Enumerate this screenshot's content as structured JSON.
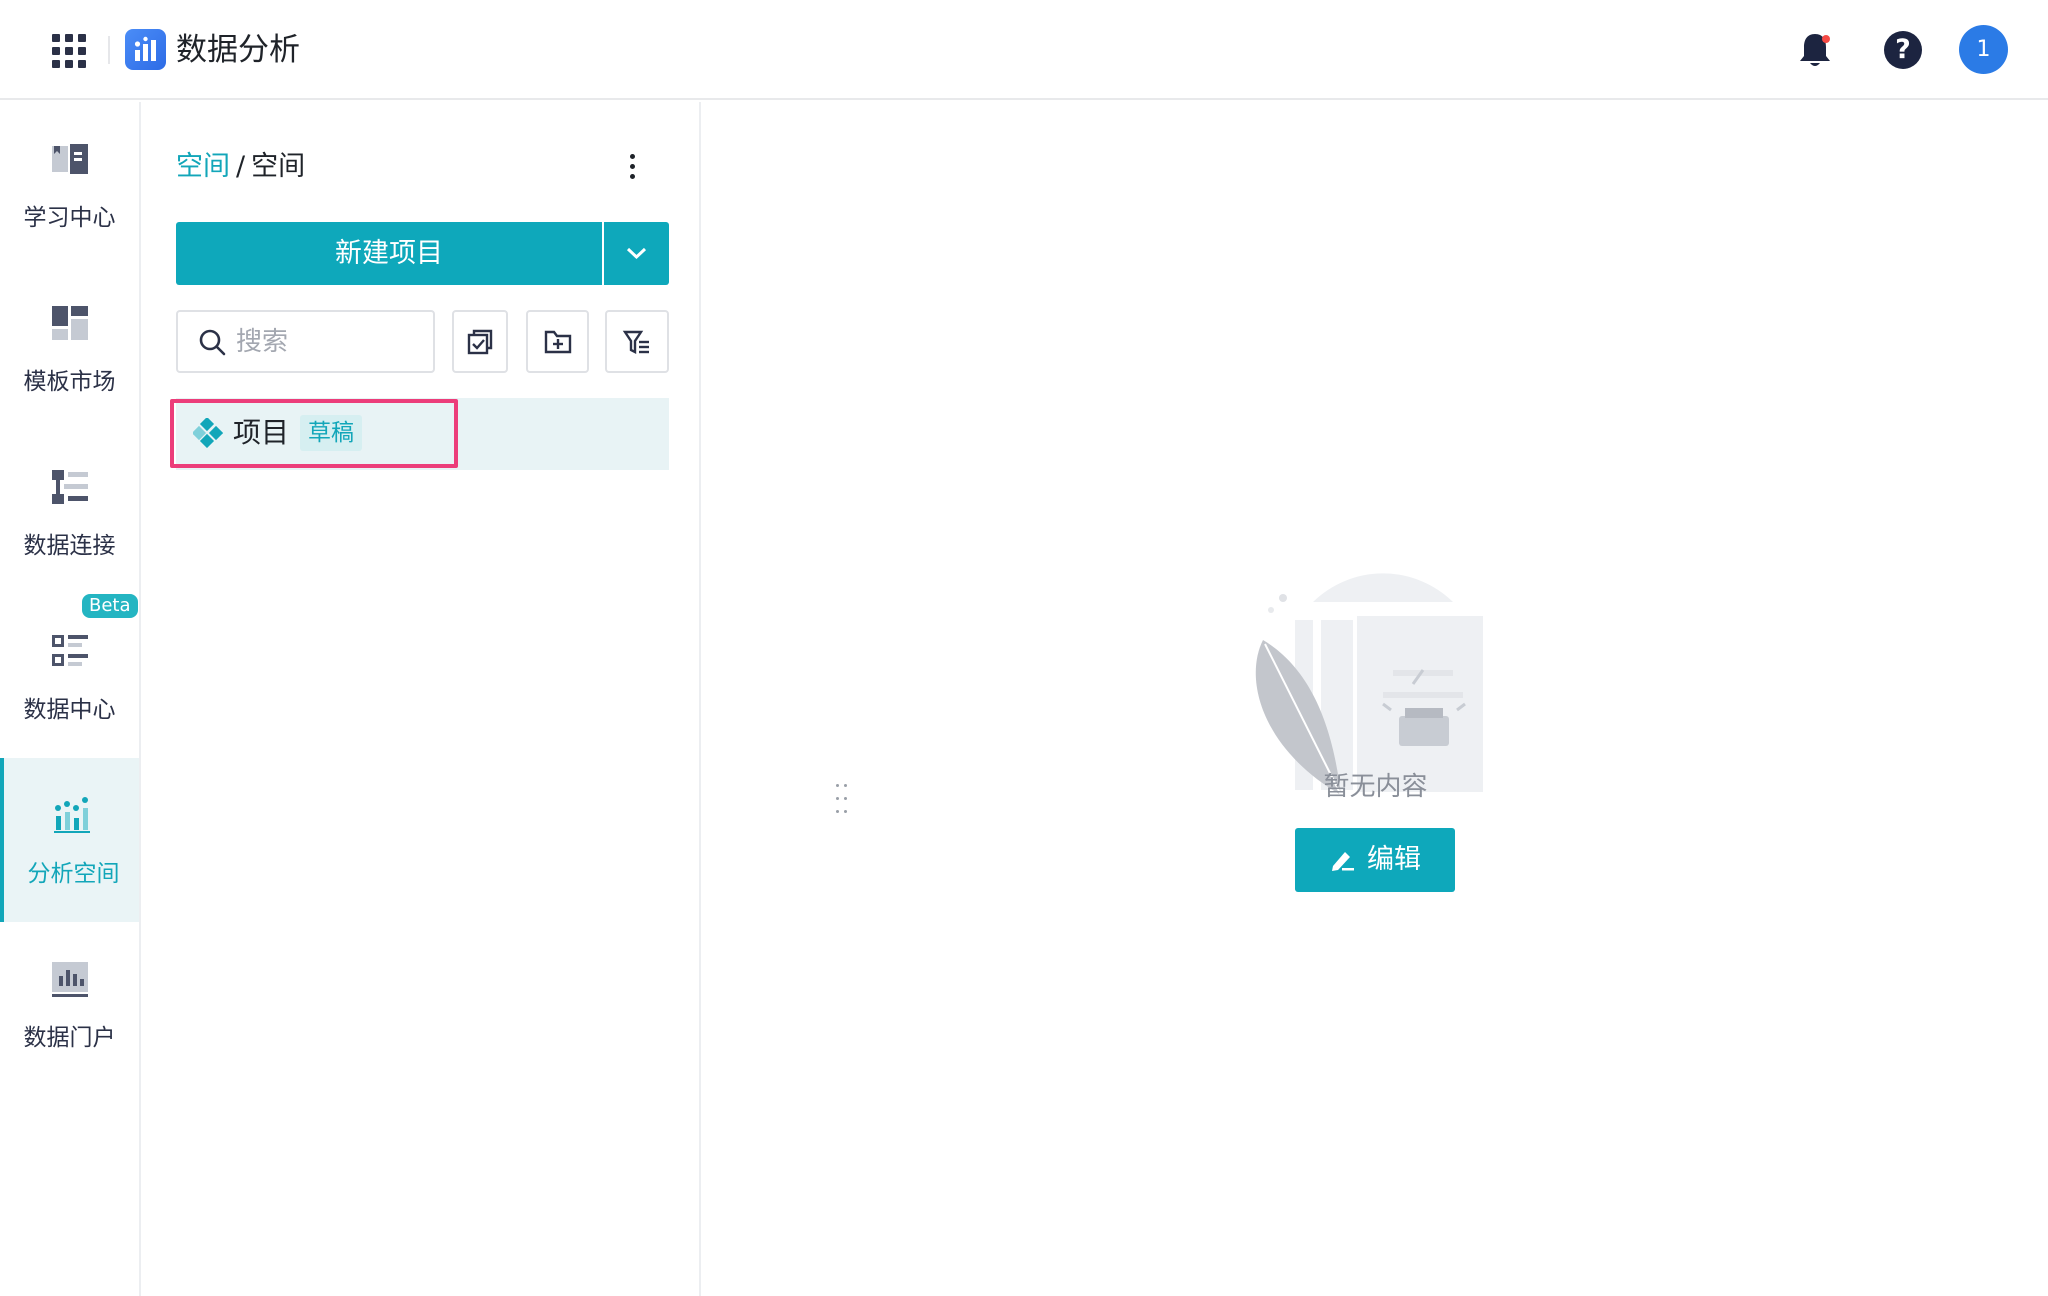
{
  "app": {
    "title": "数据分析"
  },
  "header": {
    "avatar_text": "1"
  },
  "nav": {
    "items": [
      {
        "label": "学习中心",
        "icon": "book-icon"
      },
      {
        "label": "模板市场",
        "icon": "template-icon"
      },
      {
        "label": "数据连接",
        "icon": "data-connect-icon"
      },
      {
        "label": "数据中心",
        "icon": "data-center-icon",
        "badge": "Beta"
      },
      {
        "label": "分析空间",
        "icon": "analysis-icon",
        "active": true
      },
      {
        "label": "数据门户",
        "icon": "portal-icon"
      }
    ]
  },
  "panel": {
    "breadcrumb": {
      "link": "空间",
      "separator": "/",
      "current": "空间"
    },
    "new_button": "新建项目",
    "search": {
      "placeholder": "搜索",
      "value": ""
    },
    "tree": [
      {
        "name": "项目",
        "badge": "草稿",
        "selected": true
      }
    ]
  },
  "main": {
    "empty_text": "暂无内容",
    "edit_button": "编辑"
  },
  "colors": {
    "accent": "#0ea8bb",
    "highlight": "#ec3d7a",
    "text": "#1f2329"
  }
}
